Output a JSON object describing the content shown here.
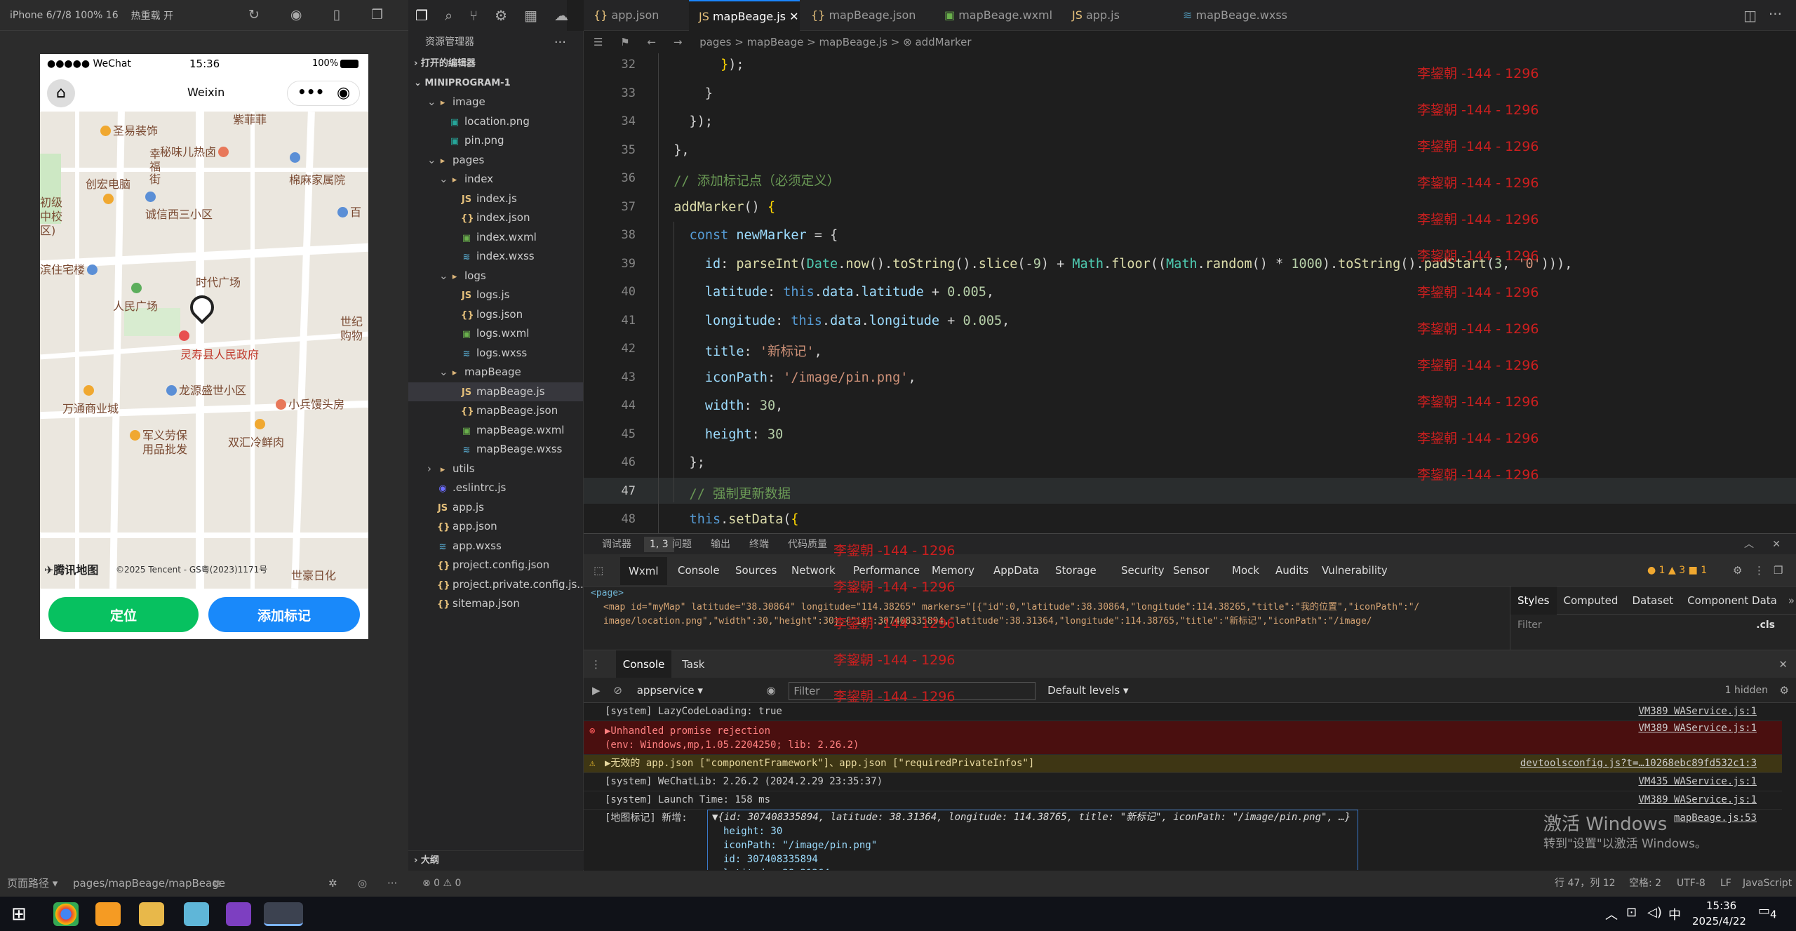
{
  "simulator": {
    "device": "iPhone 6/7/8 100% 16",
    "hot_reload": "热重载 开"
  },
  "phone": {
    "carrier": "●●●●● WeChat",
    "time": "15:36",
    "battery": "100%",
    "title": "Weixin",
    "btn_locate": "定位",
    "btn_add": "添加标记",
    "map_brand": "腾讯地图",
    "map_copyright": "©2025 Tencent - GS粤(2023)1171号",
    "labels": [
      "紫菲菲",
      "圣易装饰",
      "秘味儿热卤",
      "棉麻家属院",
      "幸福街",
      "创宏电脑",
      "诚信西三小区",
      "初级中校区)",
      "百",
      "时代广场",
      "滨住宅楼",
      "人民广场",
      "灵寿县人民政府",
      "世纪购物",
      "龙源盛世小区",
      "万通商业城",
      "小兵馒头房",
      "军义劳保用品批发",
      "双汇冷鲜肉",
      "世豪日化"
    ]
  },
  "explorer": {
    "title": "资源管理器",
    "open_editors": "打开的编辑器",
    "project": "MINIPROGRAM-1",
    "outline": "大纲",
    "items": [
      {
        "n": "image",
        "t": "folder",
        "d": 1
      },
      {
        "n": "location.png",
        "t": "img",
        "d": 2
      },
      {
        "n": "pin.png",
        "t": "img",
        "d": 2
      },
      {
        "n": "pages",
        "t": "folder",
        "d": 1
      },
      {
        "n": "index",
        "t": "folder",
        "d": 2
      },
      {
        "n": "index.js",
        "t": "js",
        "d": 3
      },
      {
        "n": "index.json",
        "t": "json",
        "d": 3
      },
      {
        "n": "index.wxml",
        "t": "wxml",
        "d": 3
      },
      {
        "n": "index.wxss",
        "t": "wxss",
        "d": 3
      },
      {
        "n": "logs",
        "t": "folder",
        "d": 2
      },
      {
        "n": "logs.js",
        "t": "js",
        "d": 3
      },
      {
        "n": "logs.json",
        "t": "json",
        "d": 3
      },
      {
        "n": "logs.wxml",
        "t": "wxml",
        "d": 3
      },
      {
        "n": "logs.wxss",
        "t": "wxss",
        "d": 3
      },
      {
        "n": "mapBeage",
        "t": "folder",
        "d": 2
      },
      {
        "n": "mapBeage.js",
        "t": "js",
        "d": 3,
        "sel": true
      },
      {
        "n": "mapBeage.json",
        "t": "json",
        "d": 3
      },
      {
        "n": "mapBeage.wxml",
        "t": "wxml",
        "d": 3
      },
      {
        "n": "mapBeage.wxss",
        "t": "wxss",
        "d": 3
      },
      {
        "n": "utils",
        "t": "folder",
        "d": 1,
        "closed": true
      },
      {
        "n": ".eslintrc.js",
        "t": "eslint",
        "d": 1
      },
      {
        "n": "app.js",
        "t": "js",
        "d": 1
      },
      {
        "n": "app.json",
        "t": "json",
        "d": 1
      },
      {
        "n": "app.wxss",
        "t": "wxss",
        "d": 1
      },
      {
        "n": "project.config.json",
        "t": "json",
        "d": 1
      },
      {
        "n": "project.private.config.js...",
        "t": "json",
        "d": 1
      },
      {
        "n": "sitemap.json",
        "t": "json",
        "d": 1
      }
    ]
  },
  "tabs": [
    "app.json",
    "mapBeage.js",
    "mapBeage.json",
    "mapBeage.wxml",
    "app.js",
    "mapBeage.wxss"
  ],
  "breadcrumb": "pages > mapBeage > mapBeage.js > ⊗ addMarker",
  "watermark": "李鋆朝 -144 - 1296",
  "code_lines": [
    "32",
    "33",
    "34",
    "35",
    "36",
    "37",
    "38",
    "39",
    "40",
    "41",
    "42",
    "43",
    "44",
    "45",
    "46",
    "47",
    "48"
  ],
  "devtools": {
    "top": [
      "调试器",
      "1, 3",
      "问题",
      "输出",
      "终端",
      "代码质量"
    ],
    "tabs": [
      "Wxml",
      "Console",
      "Sources",
      "Network",
      "Performance",
      "Memory",
      "AppData",
      "Storage",
      "Security",
      "Sensor",
      "Mock",
      "Audits",
      "Vulnerability"
    ],
    "counts": "● 1  ▲ 3  ■ 1",
    "style_tabs": [
      "Styles",
      "Computed",
      "Dataset",
      "Component Data"
    ],
    "filter": "Filter",
    "cls": ".cls",
    "wxml1": "<page>",
    "wxml2": "<map id=\"myMap\" latitude=\"38.30864\" longitude=\"114.38265\" markers=\"[{\"id\":0,\"latitude\":38.30864,\"longitude\":114.38265,\"title\":\"我的位置\",\"iconPath\":\"/",
    "wxml3": "image/location.png\",\"width\":30,\"height\":30},{\"id\":307408335894,\"latitude\":38.31364,\"longitude\":114.38765,\"title\":\"新标记\",\"iconPath\":\"/image/",
    "con_tabs": [
      "Console",
      "Task"
    ],
    "context": "appservice",
    "levels": "Default levels",
    "hidden": "1 hidden"
  },
  "console": [
    {
      "k": "n",
      "t": "[system] LazyCodeLoading: true",
      "s": "VM389 WAService.js:1"
    },
    {
      "k": "e",
      "t": "▶Unhandled promise rejection",
      "t2": "(env: Windows,mp,1.05.2204250; lib: 2.26.2)",
      "s": "VM389 WAService.js:1"
    },
    {
      "k": "w",
      "t": "▶无效的 app.json [\"componentFramework\"]、app.json [\"requiredPrivateInfos\"]",
      "s": "devtoolsconfig.js?t=…10268ebc89fd532c1:3"
    },
    {
      "k": "n",
      "t": "[system] WeChatLib: 2.26.2 (2024.2.29 23:35:37)",
      "s": "VM435 WAService.js:1"
    },
    {
      "k": "n",
      "t": "[system] Launch Time: 158 ms",
      "s": "VM389 WAService.js:1"
    }
  ],
  "marker_log": {
    "prefix": "[地图标记] 新增:",
    "summary": "▼{id: 307408335894, latitude: 38.31364, longitude: 114.38765, title: \"新标记\", iconPath: \"/image/pin.png\", …}",
    "src": "mapBeage.js:53",
    "props": [
      "height: 30",
      "iconPath: \"/image/pin.png\"",
      "id: 307408335894",
      "latitude: 38.31364"
    ]
  },
  "activate": {
    "l1": "激活 Windows",
    "l2": "转到\"设置\"以激活 Windows。"
  },
  "statusbar": {
    "path_label": "页面路径 ▾",
    "path": "pages/mapBeage/mapBeage",
    "errors": "⊗ 0 ⚠ 0",
    "pos": "行 47，列 12",
    "spaces": "空格: 2",
    "enc": "UTF-8",
    "eol": "LF",
    "lang": "JavaScript"
  },
  "taskbar": {
    "time": "15:36",
    "date": "2025/4/22",
    "ime": "中",
    "notif": "4"
  }
}
